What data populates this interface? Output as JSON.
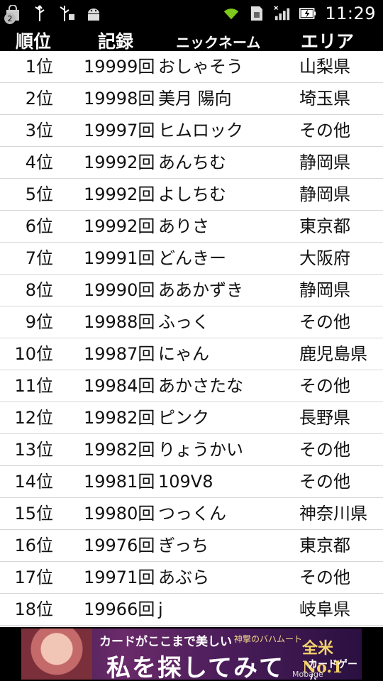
{
  "status_bar": {
    "notification_count": "2",
    "time": "11:29",
    "icons": [
      "bag-icon",
      "usb-icon",
      "usb-debug-icon",
      "android-icon",
      "wifi-icon",
      "sim-icon",
      "signal-icon",
      "battery-charging-icon"
    ]
  },
  "table": {
    "headers": {
      "rank": "順位",
      "record": "記録",
      "nickname": "ニックネーム",
      "area": "エリア"
    },
    "rows": [
      {
        "rank": "1位",
        "record": "19999回",
        "nickname": "おしゃそう",
        "area": "山梨県"
      },
      {
        "rank": "2位",
        "record": "19998回",
        "nickname": "美月 陽向",
        "area": "埼玉県"
      },
      {
        "rank": "3位",
        "record": "19997回",
        "nickname": "ヒムロック",
        "area": "その他"
      },
      {
        "rank": "4位",
        "record": "19992回",
        "nickname": "あんちむ",
        "area": "静岡県"
      },
      {
        "rank": "5位",
        "record": "19992回",
        "nickname": "よしちむ",
        "area": "静岡県"
      },
      {
        "rank": "6位",
        "record": "19992回",
        "nickname": "ありさ",
        "area": "東京都"
      },
      {
        "rank": "7位",
        "record": "19991回",
        "nickname": "どんきー",
        "area": "大阪府"
      },
      {
        "rank": "8位",
        "record": "19990回",
        "nickname": "ああかずき",
        "area": "静岡県"
      },
      {
        "rank": "9位",
        "record": "19988回",
        "nickname": "ふっく",
        "area": "その他"
      },
      {
        "rank": "10位",
        "record": "19987回",
        "nickname": "にゃん",
        "area": "鹿児島県"
      },
      {
        "rank": "11位",
        "record": "19984回",
        "nickname": "あかさたな",
        "area": "その他"
      },
      {
        "rank": "12位",
        "record": "19982回",
        "nickname": "ピンク",
        "area": "長野県"
      },
      {
        "rank": "13位",
        "record": "19982回",
        "nickname": "りょうかい",
        "area": "その他"
      },
      {
        "rank": "14位",
        "record": "19981回",
        "nickname": "109V8",
        "area": "その他"
      },
      {
        "rank": "15位",
        "record": "19980回",
        "nickname": "つっくん",
        "area": "神奈川県"
      },
      {
        "rank": "16位",
        "record": "19976回",
        "nickname": "ぎっち",
        "area": "東京都"
      },
      {
        "rank": "17位",
        "record": "19971回",
        "nickname": "あぶら",
        "area": "その他"
      },
      {
        "rank": "18位",
        "record": "19966回",
        "nickname": "j",
        "area": "岐阜県"
      }
    ]
  },
  "ad_banner": {
    "line1": "カードがここまで美しい",
    "line2": "私を探してみて",
    "game_title": "神撃のバハムート",
    "badge": "全米No.1",
    "badge_sub": "カードゲーム",
    "brand": "Mobage"
  }
}
